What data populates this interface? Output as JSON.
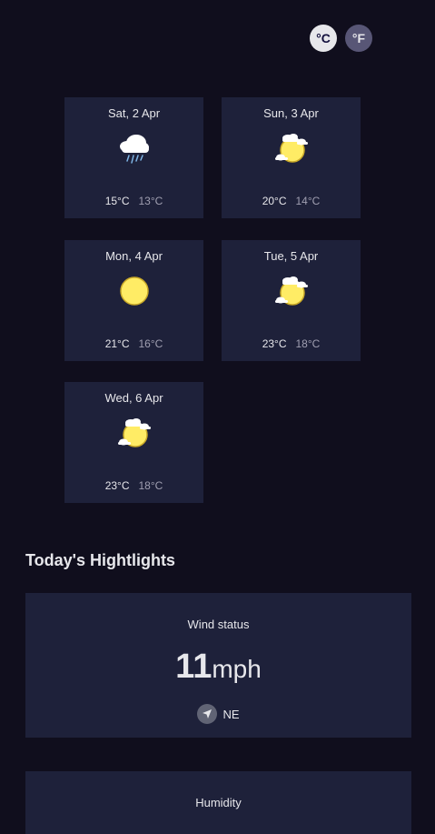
{
  "units": {
    "celsius_label": "°C",
    "fahrenheit_label": "°F"
  },
  "forecast": [
    {
      "date": "Sat, 2 Apr",
      "icon": "light-rain-icon",
      "max": "15°C",
      "min": "13°C"
    },
    {
      "date": "Sun, 3 Apr",
      "icon": "light-cloud-icon",
      "max": "20°C",
      "min": "14°C"
    },
    {
      "date": "Mon, 4 Apr",
      "icon": "clear-sun-icon",
      "max": "21°C",
      "min": "16°C"
    },
    {
      "date": "Tue, 5 Apr",
      "icon": "light-cloud-icon",
      "max": "23°C",
      "min": "18°C"
    },
    {
      "date": "Wed, 6 Apr",
      "icon": "light-cloud-icon",
      "max": "23°C",
      "min": "18°C"
    }
  ],
  "highlights": {
    "title": "Today's Hightlights",
    "wind": {
      "label": "Wind status",
      "value": "11",
      "unit": "mph",
      "direction": "NE",
      "icon": "navigation-arrow-icon"
    },
    "humidity": {
      "label": "Humidity"
    }
  },
  "colors": {
    "background": "#100e1d",
    "card": "#1e213a",
    "sun": "#ffec65"
  }
}
